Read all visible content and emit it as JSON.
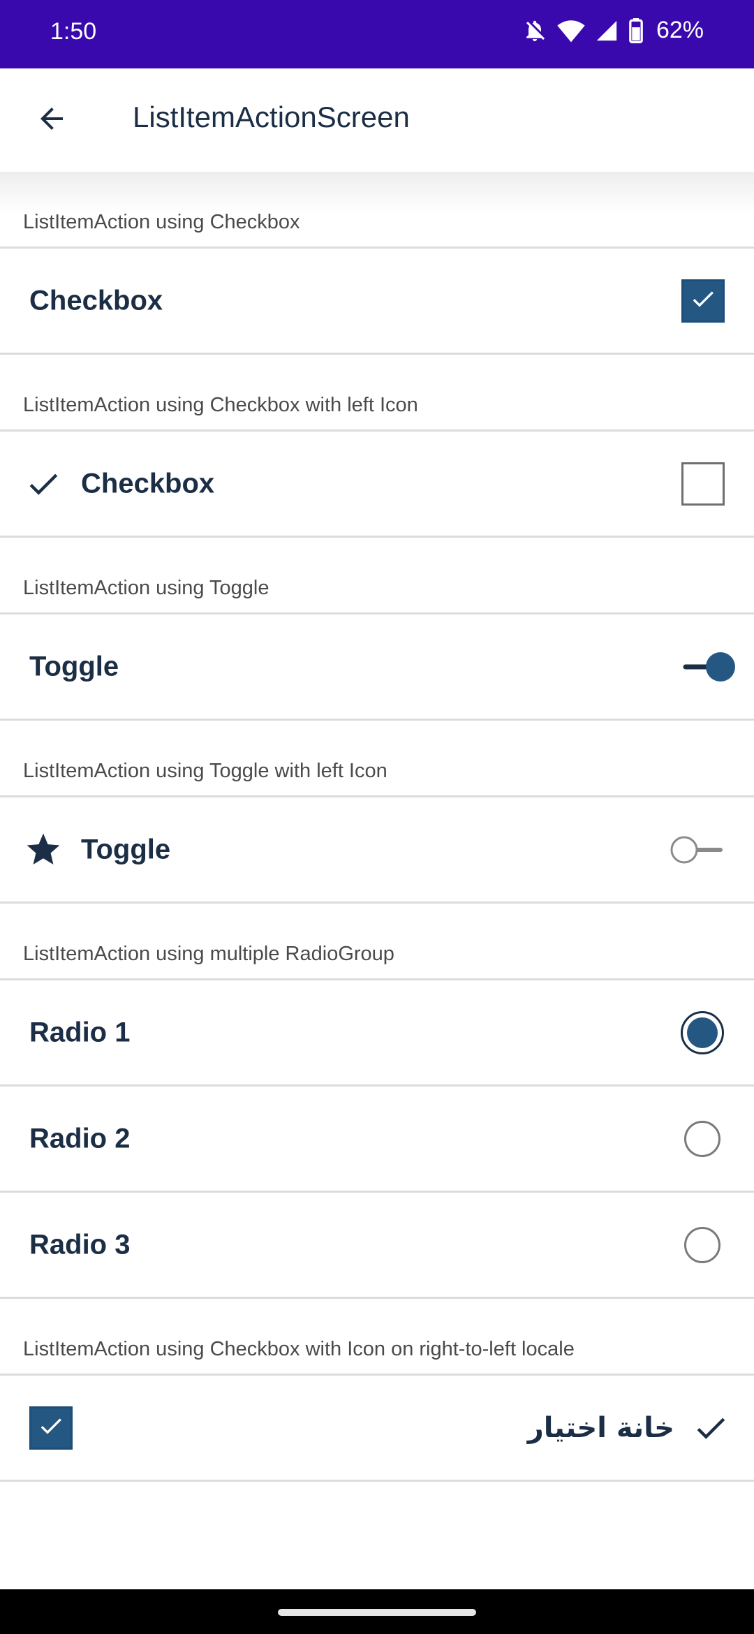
{
  "status_bar": {
    "time": "1:50",
    "battery": "62%",
    "icons": [
      "notifications-off-icon",
      "wifi-icon",
      "signal-icon",
      "battery-icon"
    ],
    "bg_color": "#3a09ad"
  },
  "app_bar": {
    "title": "ListItemActionScreen",
    "back_icon": "arrow-back-icon"
  },
  "sections": {
    "checkbox": {
      "header": "ListItemAction using Checkbox",
      "row_label": "Checkbox",
      "checked": true
    },
    "checkbox_left_icon": {
      "header": "ListItemAction using Checkbox with left Icon",
      "row_label": "Checkbox",
      "left_icon": "check-icon",
      "checked": false
    },
    "toggle": {
      "header": "ListItemAction using Toggle",
      "row_label": "Toggle",
      "on": true
    },
    "toggle_left_icon": {
      "header": "ListItemAction using Toggle with left Icon",
      "row_label": "Toggle",
      "left_icon": "star-icon",
      "on": false
    },
    "radio_group": {
      "header": "ListItemAction using multiple RadioGroup",
      "items": [
        {
          "label": "Radio 1",
          "selected": true
        },
        {
          "label": "Radio 2",
          "selected": false
        },
        {
          "label": "Radio 3",
          "selected": false
        }
      ]
    },
    "rtl_checkbox": {
      "header": "ListItemAction using Checkbox with Icon on right-to-left locale",
      "row_label": "خانة اختيار",
      "left_icon": "check-icon",
      "checked": true
    }
  },
  "colors": {
    "accent": "#255783",
    "text": "#1b2e45",
    "divider": "#dcdcdc"
  }
}
